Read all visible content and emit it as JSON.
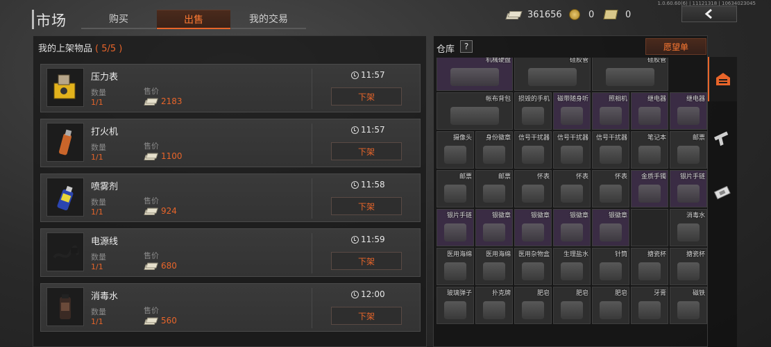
{
  "header": {
    "title": "市场",
    "tabs": [
      {
        "label": "购买",
        "active": false
      },
      {
        "label": "出售",
        "active": true
      },
      {
        "label": "我的交易",
        "active": false
      }
    ],
    "currency": {
      "cash": "361656",
      "coins": "0",
      "tickets": "0"
    },
    "version": "1.0.60.60(6) | 11121318 | 10634023045",
    "back_icon": "chevron-left-icon"
  },
  "listings_panel": {
    "title": "我的上架物品",
    "count": "( 5/5 )",
    "qty_label": "数量",
    "price_label": "售价",
    "delist_label": "下架",
    "items": [
      {
        "name": "压力表",
        "qty": "1/1",
        "price": "2183",
        "time": "11:57",
        "icon": "pressure-gauge-icon"
      },
      {
        "name": "打火机",
        "qty": "1/1",
        "price": "1100",
        "time": "11:57",
        "icon": "lighter-icon"
      },
      {
        "name": "喷雾剂",
        "qty": "1/1",
        "price": "924",
        "time": "11:58",
        "icon": "spray-can-icon"
      },
      {
        "name": "电源线",
        "qty": "1/1",
        "price": "680",
        "time": "11:59",
        "icon": "power-cord-icon"
      },
      {
        "name": "消毒水",
        "qty": "1/1",
        "price": "560",
        "time": "12:00",
        "icon": "disinfectant-icon"
      }
    ]
  },
  "storage_panel": {
    "title": "仓库",
    "help": "?",
    "wishlist": "愿望单",
    "cells": [
      {
        "label": "机械硬盘",
        "row": 0,
        "col": 0,
        "wide": true,
        "purple": true
      },
      {
        "label": "硅胶管",
        "row": 0,
        "col": 2,
        "wide": true
      },
      {
        "label": "硅胶管",
        "row": 0,
        "col": 4,
        "wide": true
      },
      {
        "label": "帐布背包",
        "row": 1,
        "col": 0,
        "wide": true
      },
      {
        "label": "损毁的手机",
        "row": 1,
        "col": 2
      },
      {
        "label": "磁带随身听",
        "row": 1,
        "col": 3,
        "purple": true
      },
      {
        "label": "照相机",
        "row": 1,
        "col": 4,
        "purple": true
      },
      {
        "label": "继电器",
        "row": 1,
        "col": 5,
        "purple": true
      },
      {
        "label": "继电器",
        "row": 1,
        "col": 6,
        "purple": true
      },
      {
        "label": "摄像头",
        "row": 2,
        "col": 0
      },
      {
        "label": "身份徽章",
        "row": 2,
        "col": 1
      },
      {
        "label": "信号干扰器",
        "row": 2,
        "col": 2
      },
      {
        "label": "信号干扰器",
        "row": 2,
        "col": 3
      },
      {
        "label": "信号干扰器",
        "row": 2,
        "col": 4
      },
      {
        "label": "笔记本",
        "row": 2,
        "col": 5
      },
      {
        "label": "邮票",
        "row": 2,
        "col": 6
      },
      {
        "label": "邮票",
        "row": 3,
        "col": 0
      },
      {
        "label": "邮票",
        "row": 3,
        "col": 1
      },
      {
        "label": "怀表",
        "row": 3,
        "col": 2
      },
      {
        "label": "怀表",
        "row": 3,
        "col": 3
      },
      {
        "label": "怀表",
        "row": 3,
        "col": 4
      },
      {
        "label": "金质手镯",
        "row": 3,
        "col": 5,
        "purple": true
      },
      {
        "label": "银片手链",
        "row": 3,
        "col": 6,
        "purple": true
      },
      {
        "label": "银片手链",
        "row": 4,
        "col": 0,
        "purple": true
      },
      {
        "label": "银徽章",
        "row": 4,
        "col": 1,
        "purple": true
      },
      {
        "label": "银徽章",
        "row": 4,
        "col": 2,
        "purple": true
      },
      {
        "label": "银徽章",
        "row": 4,
        "col": 3,
        "purple": true
      },
      {
        "label": "银徽章",
        "row": 4,
        "col": 4,
        "purple": true
      },
      {
        "label": "",
        "row": 4,
        "col": 5,
        "empty": true
      },
      {
        "label": "消毒水",
        "row": 4,
        "col": 6
      },
      {
        "label": "医用海绵",
        "row": 5,
        "col": 0
      },
      {
        "label": "医用海绵",
        "row": 5,
        "col": 1
      },
      {
        "label": "医用杂物盒",
        "row": 5,
        "col": 2
      },
      {
        "label": "生理盐水",
        "row": 5,
        "col": 3
      },
      {
        "label": "针筒",
        "row": 5,
        "col": 4
      },
      {
        "label": "搪瓷杯",
        "row": 5,
        "col": 5
      },
      {
        "label": "搪瓷杯",
        "row": 5,
        "col": 6
      },
      {
        "label": "玻璃弹子",
        "row": 6,
        "col": 0
      },
      {
        "label": "扑克牌",
        "row": 6,
        "col": 1
      },
      {
        "label": "肥皂",
        "row": 6,
        "col": 2
      },
      {
        "label": "肥皂",
        "row": 6,
        "col": 3
      },
      {
        "label": "肥皂",
        "row": 6,
        "col": 4
      },
      {
        "label": "牙膏",
        "row": 6,
        "col": 5
      },
      {
        "label": "磁铁",
        "row": 6,
        "col": 6
      }
    ]
  },
  "sidebar": {
    "tabs": [
      {
        "icon": "storage-icon",
        "active": true
      },
      {
        "icon": "pistol-icon",
        "active": false
      },
      {
        "icon": "cash-icon",
        "active": false
      }
    ]
  },
  "colors": {
    "accent": "#e8652a",
    "panel": "#181818",
    "purple_rarity": "#3a2c44"
  }
}
